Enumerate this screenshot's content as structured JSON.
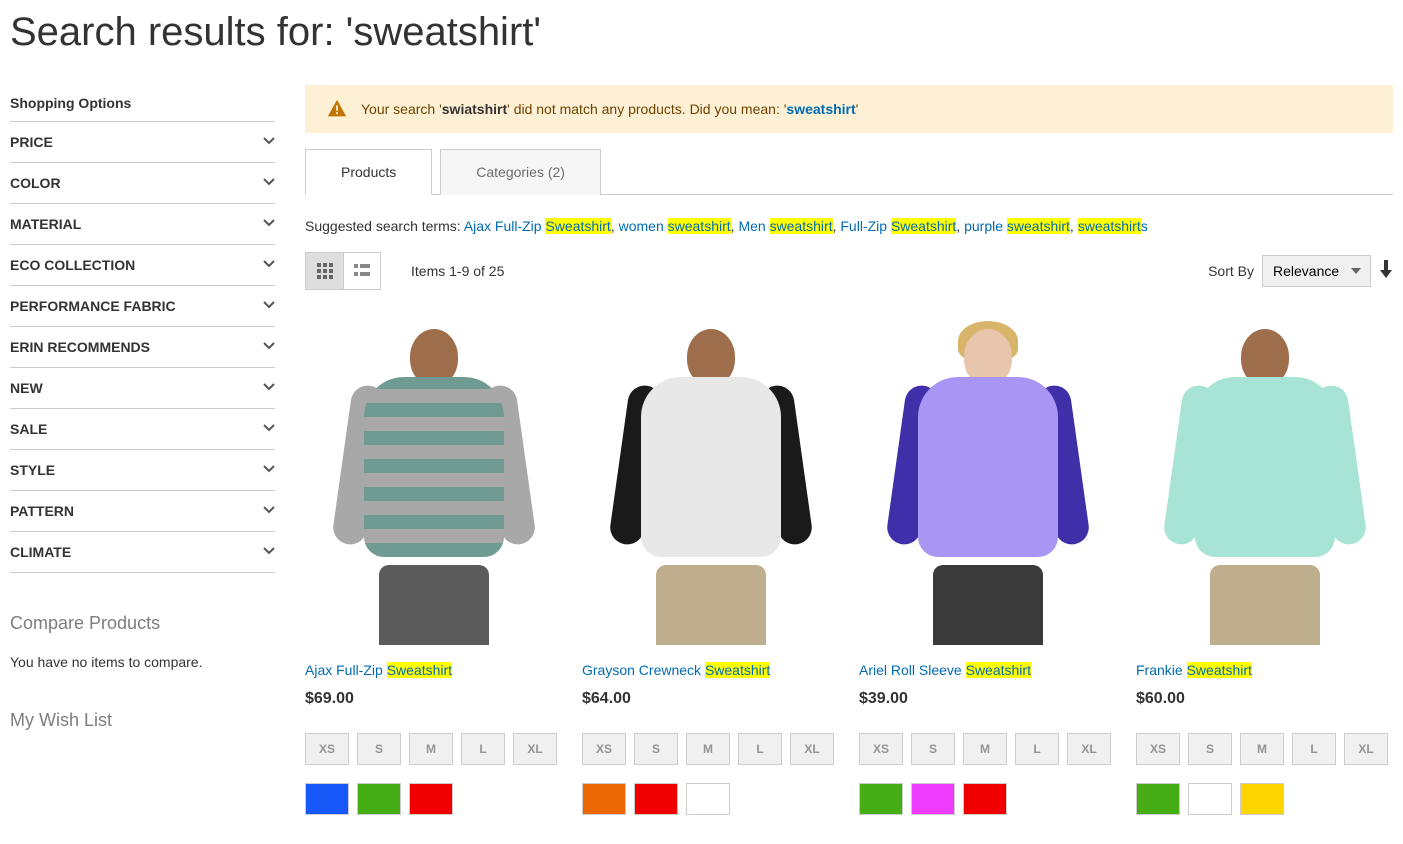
{
  "page_title": "Search results for: 'sweatshirt'",
  "sidebar": {
    "shopping_options_title": "Shopping Options",
    "filters": [
      "PRICE",
      "COLOR",
      "MATERIAL",
      "ECO COLLECTION",
      "PERFORMANCE FABRIC",
      "ERIN RECOMMENDS",
      "NEW",
      "SALE",
      "STYLE",
      "PATTERN",
      "CLIMATE"
    ],
    "compare_title": "Compare Products",
    "compare_empty": "You have no items to compare.",
    "wishlist_title": "My Wish List"
  },
  "message": {
    "prefix": "Your search '",
    "misspelled": "swiatshirt",
    "mid": "' did not match any products. Did you mean:  '",
    "link": "sweatshirt",
    "suffix": "'"
  },
  "tabs": {
    "products": "Products",
    "categories": "Categories (2)"
  },
  "suggested": {
    "label": "Suggested search terms: ",
    "terms": [
      {
        "pre": "Ajax Full-Zip ",
        "hl": "Sweatshirt",
        "post": ""
      },
      {
        "pre": "women ",
        "hl": "sweatshirt",
        "post": ""
      },
      {
        "pre": "Men ",
        "hl": "sweatshirt",
        "post": ""
      },
      {
        "pre": "Full-Zip ",
        "hl": "Sweatshirt",
        "post": ""
      },
      {
        "pre": "purple ",
        "hl": "sweatshirt",
        "post": ""
      },
      {
        "pre": "",
        "hl": "sweatshirt",
        "post": "s"
      }
    ]
  },
  "toolbar": {
    "count": "Items 1-9 of 25",
    "sort_label": "Sort By",
    "sort_value": "Relevance"
  },
  "sizes": [
    "XS",
    "S",
    "M",
    "L",
    "XL"
  ],
  "products": [
    {
      "name_pre": "Ajax Full-Zip ",
      "name_hl": "Sweatshirt",
      "name_post": "",
      "price": "$69.00",
      "colors": [
        "#1857f7",
        "#46ae14",
        "#f10000"
      ],
      "fig": {
        "skin": "#9e6e4c",
        "shirt": "#6f9b92",
        "shirt2": "#a8a8a8",
        "pants": "#5b5b5b",
        "stripes": true
      }
    },
    {
      "name_pre": "Grayson Crewneck ",
      "name_hl": "Sweatshirt",
      "name_post": "",
      "price": "$64.00",
      "colors": [
        "#eb6703",
        "#f10000",
        "#ffffff"
      ],
      "fig": {
        "skin": "#9e6e4c",
        "shirt": "#e8e8e8",
        "shirt2": "#1a1a1a",
        "pants": "#bfae8e"
      }
    },
    {
      "name_pre": "Ariel Roll Sleeve ",
      "name_hl": "Sweatshirt",
      "name_post": "",
      "price": "$39.00",
      "colors": [
        "#46ae14",
        "#ef3dff",
        "#f10000"
      ],
      "fig": {
        "skin": "#e8c6ad",
        "shirt": "#a895f4",
        "shirt2": "#3f2fa9",
        "pants": "#3a3a3a",
        "hair": "#d9b56b"
      }
    },
    {
      "name_pre": "Frankie ",
      "name_hl": "Sweatshirt",
      "name_post": "",
      "price": "$60.00",
      "colors": [
        "#46ae14",
        "#ffffff",
        "#ffd500"
      ],
      "fig": {
        "skin": "#9e6e4c",
        "shirt": "#a7e4d6",
        "shirt2": "#a7e4d6",
        "pants": "#bfae8e"
      }
    }
  ]
}
